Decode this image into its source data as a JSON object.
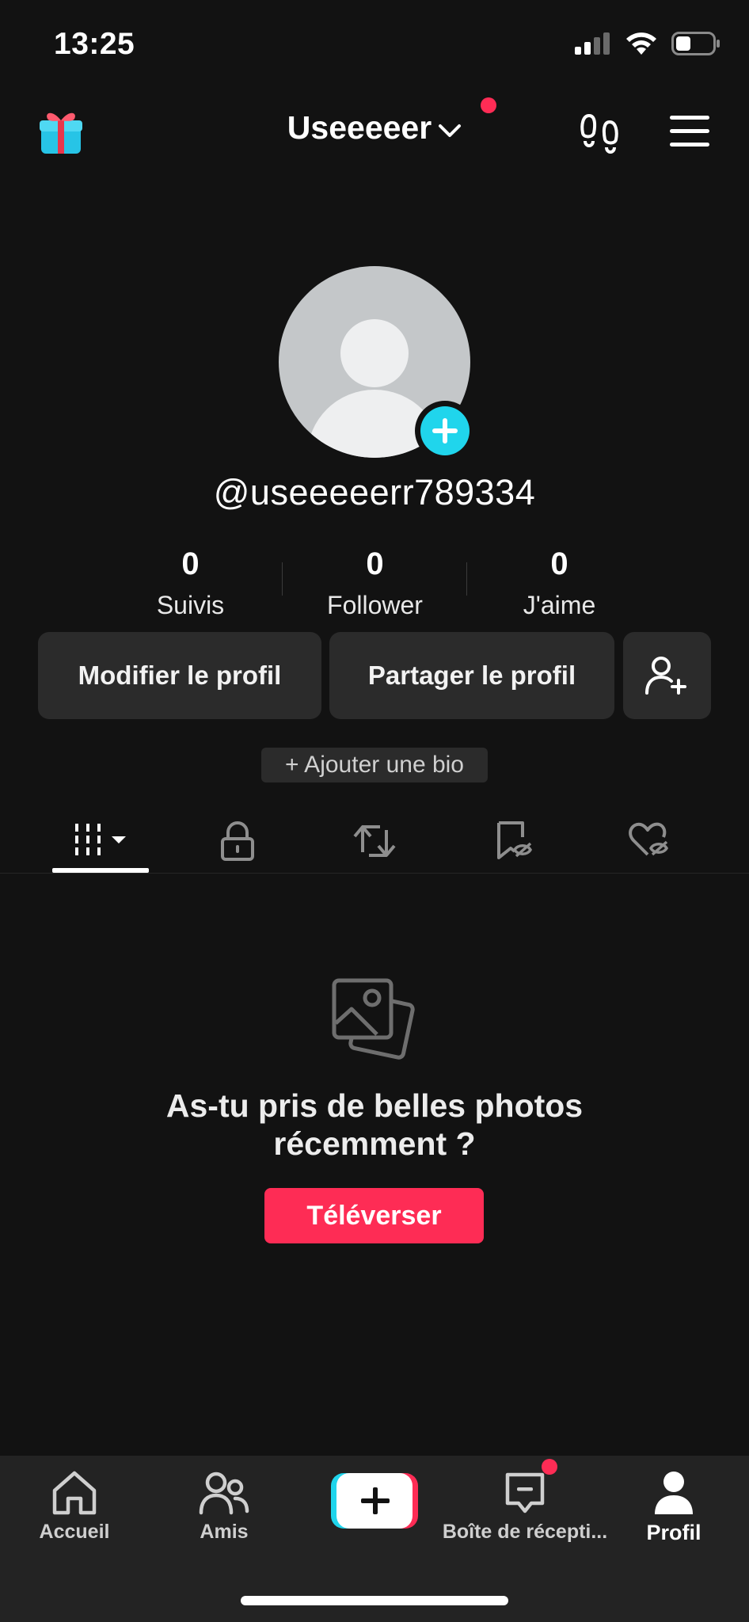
{
  "status_bar": {
    "time": "13:25",
    "signal-icon": "cellular-signal",
    "wifi-icon": "wifi",
    "battery-icon": "battery-low"
  },
  "header": {
    "account_name": "Useeeeer",
    "notification_color": "#fe2c55",
    "left_icon": "gift-icon",
    "right_icons": [
      "footprints-icon",
      "menu-icon"
    ]
  },
  "profile": {
    "username": "@useeeeerr789334",
    "stats": [
      {
        "value": "0",
        "label": "Suivis"
      },
      {
        "value": "0",
        "label": "Follower"
      },
      {
        "value": "0",
        "label": "J'aime"
      }
    ],
    "edit_button": "Modifier le profil",
    "share_button": "Partager le profil",
    "add_friend_icon": "add-friend-icon",
    "bio_button": "+ Ajouter une bio"
  },
  "tabs": [
    "videos-grid-tab",
    "private-lock-tab",
    "reposts-tab",
    "favorites-tab",
    "liked-tab"
  ],
  "empty_state": {
    "title_line1": "As-tu pris de belles photos",
    "title_line2": "récemment ?",
    "upload_button": "Téléverser",
    "accent_color": "#fe2c55"
  },
  "bottom_nav": {
    "items": [
      {
        "label": "Accueil",
        "icon": "home-icon"
      },
      {
        "label": "Amis",
        "icon": "friends-icon"
      },
      {
        "label": "",
        "icon": "create-plus-icon"
      },
      {
        "label": "Boîte de récepti...",
        "icon": "inbox-icon"
      },
      {
        "label": "Profil",
        "icon": "profile-icon"
      }
    ]
  }
}
